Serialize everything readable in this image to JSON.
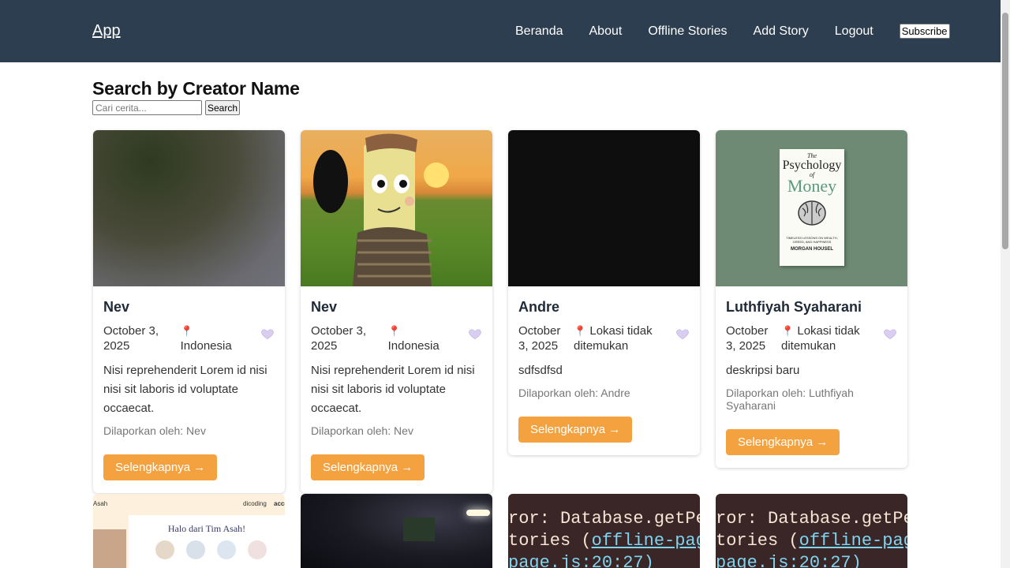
{
  "nav": {
    "brand": "App",
    "links": [
      "Beranda",
      "About",
      "Offline Stories",
      "Add Story",
      "Logout"
    ],
    "subscribe": "Subscribe"
  },
  "search": {
    "title": "Search by Creator Name",
    "placeholder": "Cari cerita...",
    "button": "Search"
  },
  "stories": [
    {
      "name": "Nev",
      "date": "October 3, 2025",
      "location": "Indonesia",
      "description": "Nisi reprehenderit Lorem id nisi nisi sit laboris id voluptate occaecat.",
      "reporter": "Dilaporkan oleh: Nev",
      "button": "Selengkapnya →"
    },
    {
      "name": "Nev",
      "date": "October 3, 2025",
      "location": "Indonesia",
      "description": "Nisi reprehenderit Lorem id nisi nisi sit laboris id voluptate occaecat.",
      "reporter": "Dilaporkan oleh: Nev",
      "button": "Selengkapnya →"
    },
    {
      "name": "Andre",
      "date": "October 3, 2025",
      "location": "Lokasi tidak ditemukan",
      "description": "sdfsdfsd",
      "reporter": "Dilaporkan oleh: Andre",
      "button": "Selengkapnya →"
    },
    {
      "name": "Luthfiyah Syaharani",
      "date": "October 3, 2025",
      "location": "Lokasi tidak ditemukan",
      "description": "deskripsi baru",
      "reporter": "Dilaporkan oleh: Luthfiyah Syaharani",
      "button": "Selengkapnya →"
    }
  ],
  "images": {
    "book_title_1": "The",
    "book_title_2": "Psychology",
    "book_title_3": "of",
    "book_title_4": "Money",
    "book_subtitle": "TIMELESS LESSONS ON WEALTH, GREED, AND HAPPINESS",
    "book_author": "MORGAN HOUSEL",
    "asah_left": "Asah",
    "asah_right": "dicoding",
    "asah_right2": "acce",
    "asah_greeting": "Halo dari Tim Asah!",
    "code_line1": "ror: Database.getPendin",
    "code_line2_a": "tories (",
    "code_line2_b": "offline-page-p",
    "code_line3": "page.js:20:27)"
  },
  "colors": {
    "navbar": "#2c3e50",
    "accent": "#f4a240",
    "pin": "#e0245e",
    "heart": "#c9b8e8"
  },
  "icons": {
    "pin": "map-pin-icon",
    "heart": "heart-icon"
  }
}
